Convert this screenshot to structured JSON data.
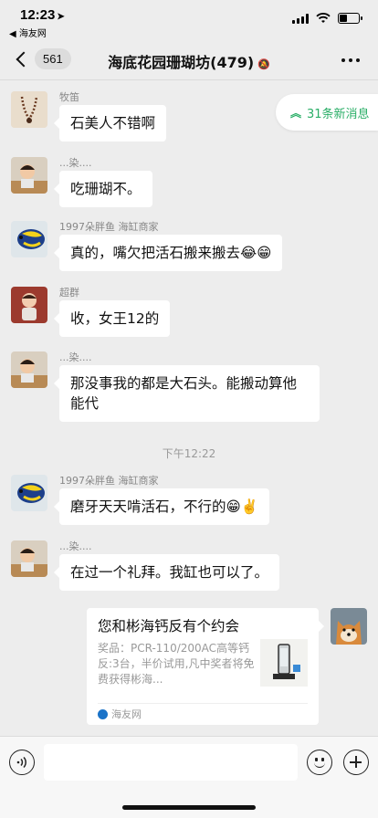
{
  "status_bar": {
    "time": "12:23",
    "back_app": "◀ 海友网"
  },
  "nav": {
    "unread_count": "561",
    "title": "海底花园珊瑚坊(479)"
  },
  "new_messages": {
    "label": "31条新消息"
  },
  "messages": [
    {
      "sender": "牧笛",
      "text": "石美人不错啊"
    },
    {
      "sender": "...染....",
      "text": "吃珊瑚不。"
    },
    {
      "sender": "1997朵胖鱼 海缸商家",
      "text": "真的，嘴欠把活石搬来搬去😂😁"
    },
    {
      "sender": "超群",
      "text": "收，女王12的"
    },
    {
      "sender": "...染....",
      "text": "那没事我的都是大石头。能搬动算他能代"
    },
    {
      "sender": "1997朵胖鱼 海缸商家",
      "text": "磨牙天天啃活石，不行的😁✌️"
    },
    {
      "sender": "...染....",
      "text": "在过一个礼拜。我缸也可以了。"
    }
  ],
  "time_separator": "下午12:22",
  "card": {
    "title": "您和彬海钙反有个约会",
    "description": "奖品：PCR-110/200AC高等钙反:3台，半价试用,凡中奖者将免费获得彬海...",
    "source": "海友网"
  },
  "input": {
    "placeholder": ""
  },
  "colors": {
    "background": "#ededed",
    "accent_green": "#2aae67",
    "bubble": "#ffffff"
  }
}
